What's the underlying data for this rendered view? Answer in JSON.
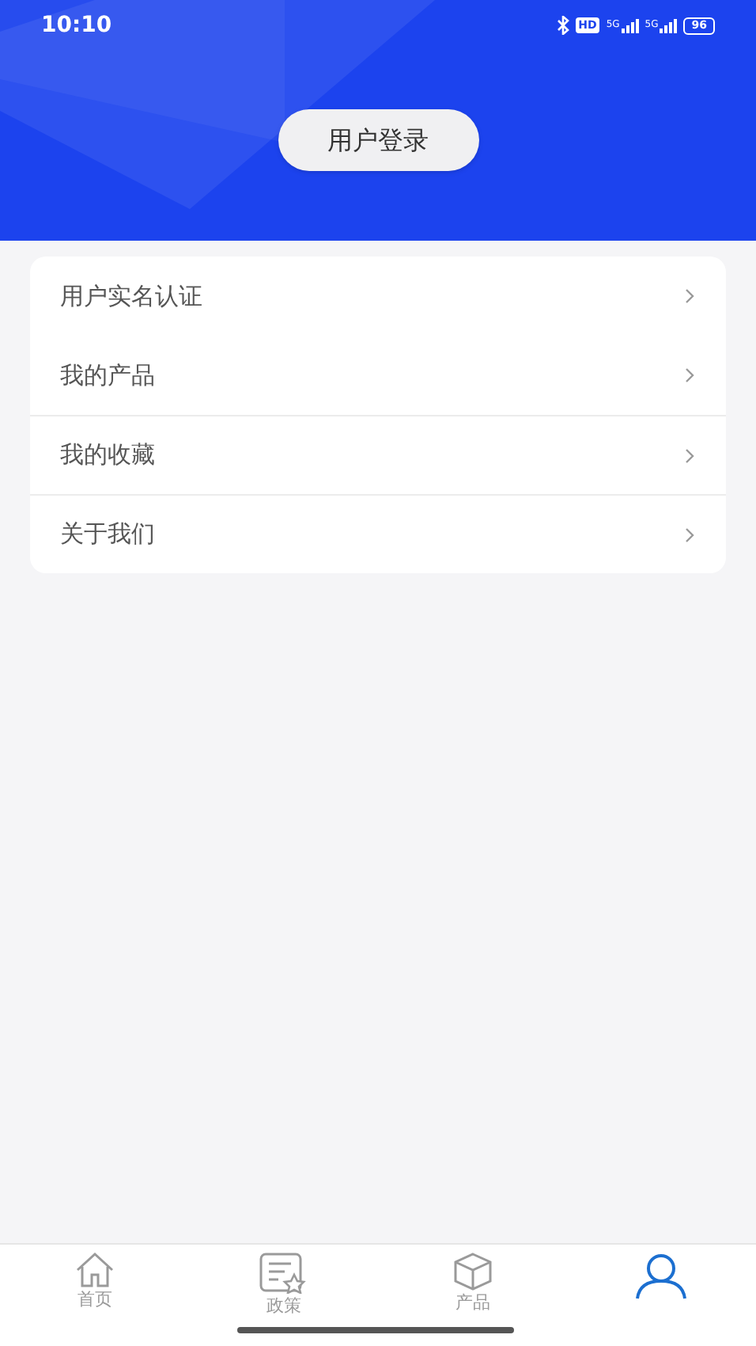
{
  "status_bar": {
    "time": "10:10",
    "hd": "HD",
    "signals": [
      "5G",
      "5G"
    ],
    "battery": "96"
  },
  "header": {
    "login_button": "用户登录"
  },
  "menu": [
    {
      "label": "用户实名认证",
      "divider": false
    },
    {
      "label": "我的产品",
      "divider": false
    },
    {
      "label": "我的收藏",
      "divider": true
    },
    {
      "label": "关于我们",
      "divider": true
    }
  ],
  "tab_bar": [
    {
      "kind": "home",
      "label": "首页",
      "selected": false
    },
    {
      "kind": "policy",
      "label": "政策",
      "selected": false
    },
    {
      "kind": "product",
      "label": "产品",
      "selected": false
    },
    {
      "kind": "profile",
      "selected": true
    }
  ]
}
